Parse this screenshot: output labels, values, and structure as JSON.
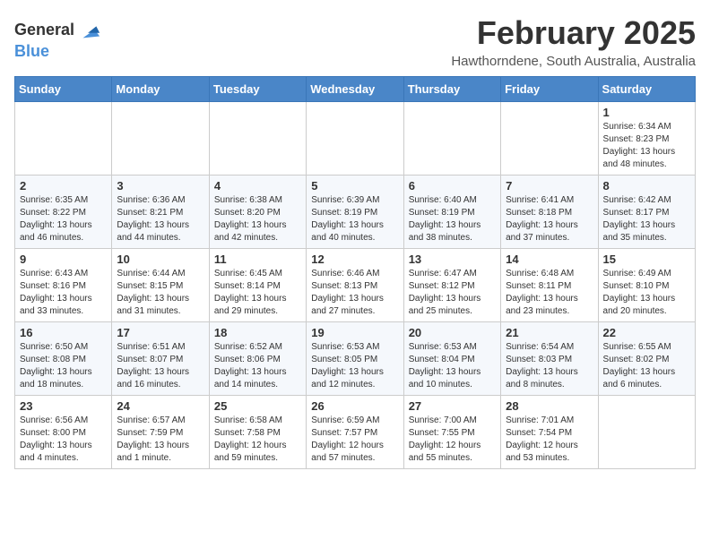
{
  "header": {
    "logo_line1": "General",
    "logo_line2": "Blue",
    "month": "February 2025",
    "location": "Hawthorndene, South Australia, Australia"
  },
  "days_of_week": [
    "Sunday",
    "Monday",
    "Tuesday",
    "Wednesday",
    "Thursday",
    "Friday",
    "Saturday"
  ],
  "weeks": [
    [
      {
        "day": "",
        "info": ""
      },
      {
        "day": "",
        "info": ""
      },
      {
        "day": "",
        "info": ""
      },
      {
        "day": "",
        "info": ""
      },
      {
        "day": "",
        "info": ""
      },
      {
        "day": "",
        "info": ""
      },
      {
        "day": "1",
        "info": "Sunrise: 6:34 AM\nSunset: 8:23 PM\nDaylight: 13 hours and 48 minutes."
      }
    ],
    [
      {
        "day": "2",
        "info": "Sunrise: 6:35 AM\nSunset: 8:22 PM\nDaylight: 13 hours and 46 minutes."
      },
      {
        "day": "3",
        "info": "Sunrise: 6:36 AM\nSunset: 8:21 PM\nDaylight: 13 hours and 44 minutes."
      },
      {
        "day": "4",
        "info": "Sunrise: 6:38 AM\nSunset: 8:20 PM\nDaylight: 13 hours and 42 minutes."
      },
      {
        "day": "5",
        "info": "Sunrise: 6:39 AM\nSunset: 8:19 PM\nDaylight: 13 hours and 40 minutes."
      },
      {
        "day": "6",
        "info": "Sunrise: 6:40 AM\nSunset: 8:19 PM\nDaylight: 13 hours and 38 minutes."
      },
      {
        "day": "7",
        "info": "Sunrise: 6:41 AM\nSunset: 8:18 PM\nDaylight: 13 hours and 37 minutes."
      },
      {
        "day": "8",
        "info": "Sunrise: 6:42 AM\nSunset: 8:17 PM\nDaylight: 13 hours and 35 minutes."
      }
    ],
    [
      {
        "day": "9",
        "info": "Sunrise: 6:43 AM\nSunset: 8:16 PM\nDaylight: 13 hours and 33 minutes."
      },
      {
        "day": "10",
        "info": "Sunrise: 6:44 AM\nSunset: 8:15 PM\nDaylight: 13 hours and 31 minutes."
      },
      {
        "day": "11",
        "info": "Sunrise: 6:45 AM\nSunset: 8:14 PM\nDaylight: 13 hours and 29 minutes."
      },
      {
        "day": "12",
        "info": "Sunrise: 6:46 AM\nSunset: 8:13 PM\nDaylight: 13 hours and 27 minutes."
      },
      {
        "day": "13",
        "info": "Sunrise: 6:47 AM\nSunset: 8:12 PM\nDaylight: 13 hours and 25 minutes."
      },
      {
        "day": "14",
        "info": "Sunrise: 6:48 AM\nSunset: 8:11 PM\nDaylight: 13 hours and 23 minutes."
      },
      {
        "day": "15",
        "info": "Sunrise: 6:49 AM\nSunset: 8:10 PM\nDaylight: 13 hours and 20 minutes."
      }
    ],
    [
      {
        "day": "16",
        "info": "Sunrise: 6:50 AM\nSunset: 8:08 PM\nDaylight: 13 hours and 18 minutes."
      },
      {
        "day": "17",
        "info": "Sunrise: 6:51 AM\nSunset: 8:07 PM\nDaylight: 13 hours and 16 minutes."
      },
      {
        "day": "18",
        "info": "Sunrise: 6:52 AM\nSunset: 8:06 PM\nDaylight: 13 hours and 14 minutes."
      },
      {
        "day": "19",
        "info": "Sunrise: 6:53 AM\nSunset: 8:05 PM\nDaylight: 13 hours and 12 minutes."
      },
      {
        "day": "20",
        "info": "Sunrise: 6:53 AM\nSunset: 8:04 PM\nDaylight: 13 hours and 10 minutes."
      },
      {
        "day": "21",
        "info": "Sunrise: 6:54 AM\nSunset: 8:03 PM\nDaylight: 13 hours and 8 minutes."
      },
      {
        "day": "22",
        "info": "Sunrise: 6:55 AM\nSunset: 8:02 PM\nDaylight: 13 hours and 6 minutes."
      }
    ],
    [
      {
        "day": "23",
        "info": "Sunrise: 6:56 AM\nSunset: 8:00 PM\nDaylight: 13 hours and 4 minutes."
      },
      {
        "day": "24",
        "info": "Sunrise: 6:57 AM\nSunset: 7:59 PM\nDaylight: 13 hours and 1 minute."
      },
      {
        "day": "25",
        "info": "Sunrise: 6:58 AM\nSunset: 7:58 PM\nDaylight: 12 hours and 59 minutes."
      },
      {
        "day": "26",
        "info": "Sunrise: 6:59 AM\nSunset: 7:57 PM\nDaylight: 12 hours and 57 minutes."
      },
      {
        "day": "27",
        "info": "Sunrise: 7:00 AM\nSunset: 7:55 PM\nDaylight: 12 hours and 55 minutes."
      },
      {
        "day": "28",
        "info": "Sunrise: 7:01 AM\nSunset: 7:54 PM\nDaylight: 12 hours and 53 minutes."
      },
      {
        "day": "",
        "info": ""
      }
    ]
  ]
}
